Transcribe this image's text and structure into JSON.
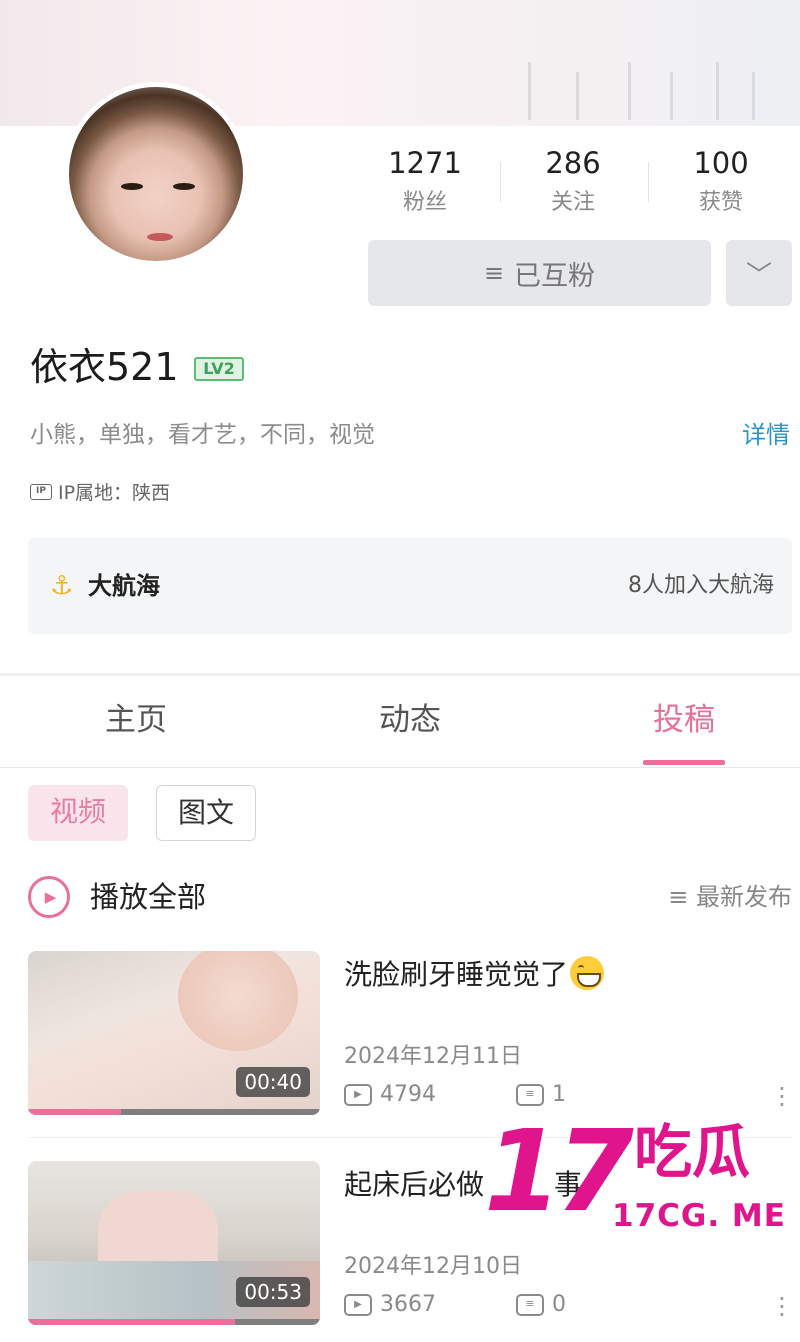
{
  "profile": {
    "name": "依衣521",
    "level": "LV2",
    "bio": "小熊，单独，看才艺，不同，视觉",
    "detail_link": "详情",
    "ip_icon": "IP",
    "ip_location": "IP属地：陕西"
  },
  "stats": [
    {
      "value": "1271",
      "label": "粉丝"
    },
    {
      "value": "286",
      "label": "关注"
    },
    {
      "value": "100",
      "label": "获赞"
    }
  ],
  "actions": {
    "follow_label": "已互粉",
    "menu_glyph": "≡",
    "more_glyph": "﹀"
  },
  "voyage": {
    "anchor_glyph": "⚓",
    "title": "大航海",
    "count": "8人加入大航海"
  },
  "tabs": [
    {
      "label": "主页",
      "active": false
    },
    {
      "label": "动态",
      "active": false
    },
    {
      "label": "投稿",
      "active": true
    }
  ],
  "filters": {
    "video": "视频",
    "text": "图文"
  },
  "list_header": {
    "play_all": "播放全部",
    "sort": "≡ 最新发布"
  },
  "videos": [
    {
      "title": "洗脸刷牙睡觉觉了",
      "emoji": "grinning-face-emoji",
      "date": "2024年12月11日",
      "views": "4794",
      "comments": "1",
      "duration": "00:40",
      "progress": 0.32
    },
    {
      "title": "起床后必做",
      "title_tail": "事",
      "date": "2024年12月10日",
      "views": "3667",
      "comments": "0",
      "duration": "00:53",
      "progress": 0.71
    }
  ],
  "watermark": {
    "number": "17",
    "chinese": "吃瓜",
    "domain": "17CG. ME"
  },
  "colors": {
    "accent": "#e8709a",
    "link": "#2a95c6",
    "level_green": "#3fa05a",
    "watermark": "#e0158b"
  }
}
